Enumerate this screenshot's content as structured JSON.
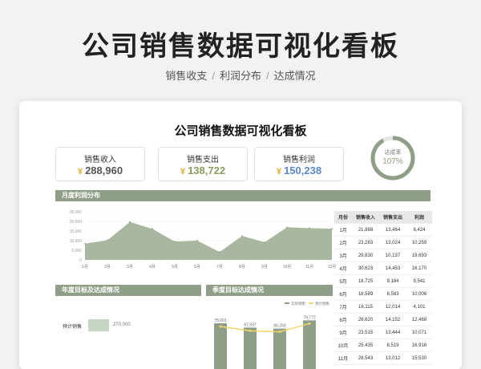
{
  "hero": {
    "title": "公司销售数据可视化看板",
    "subtitle_parts": [
      "销售收支",
      "利润分布",
      "达成情况"
    ],
    "separator": "/"
  },
  "card": {
    "title": "公司销售数据可视化看板",
    "kpis": [
      {
        "label": "销售收入",
        "value": "288,960",
        "icon": "coin-icon"
      },
      {
        "label": "销售支出",
        "value": "138,722",
        "icon": "coin-icon"
      },
      {
        "label": "销售利润",
        "value": "150,238",
        "icon": "coin-icon"
      }
    ],
    "achievement": {
      "label": "达成率",
      "value": "107%",
      "fraction": 1.07
    },
    "sections": {
      "monthly": "月度利润分布",
      "annual": "年度目标及达成情况",
      "quarterly": "季度目标达成情况"
    }
  },
  "chart_data": [
    {
      "type": "area",
      "categories": [
        "1月",
        "2月",
        "3月",
        "4月",
        "5月",
        "6月",
        "7月",
        "8月",
        "9月",
        "10月",
        "11月",
        "12月"
      ],
      "values": [
        8424,
        10259,
        19693,
        16170,
        9541,
        10006,
        4101,
        12468,
        9161,
        16916,
        16500,
        16200
      ],
      "yticks": [
        "25,000",
        "20,000",
        "15,000",
        "10,000",
        "5,000",
        "0"
      ],
      "ylim": [
        0,
        25000
      ],
      "color": "#9aaa8f"
    },
    {
      "type": "bar",
      "legend": [
        "实际销售",
        "预计销售"
      ],
      "values": [
        75001,
        67937,
        66259,
        79772
      ],
      "value_labels": [
        "75,001",
        "67,937",
        "66,259",
        "79,772"
      ],
      "colors": {
        "bar": "#8f9e87",
        "line": "#f3d66e"
      }
    },
    {
      "type": "table",
      "columns": [
        "月份",
        "销售收入",
        "销售支出",
        "利润"
      ],
      "rows": [
        [
          "1月",
          "21,888",
          "13,464",
          "8,424"
        ],
        [
          "2月",
          "23,283",
          "13,024",
          "10,259"
        ],
        [
          "3月",
          "29,830",
          "10,137",
          "19,693"
        ],
        [
          "4月",
          "30,623",
          "14,453",
          "16,170"
        ],
        [
          "5月",
          "18,725",
          "9,184",
          "9,541"
        ],
        [
          "6月",
          "18,589",
          "8,583",
          "10,006"
        ],
        [
          "7月",
          "16,115",
          "12,014",
          "4,101"
        ],
        [
          "8月",
          "26,620",
          "14,152",
          "12,468"
        ],
        [
          "9月",
          "23,515",
          "13,444",
          "10,071"
        ],
        [
          "10月",
          "25,435",
          "8,519",
          "16,916"
        ],
        [
          "11月",
          "28,543",
          "13,012",
          "15,530"
        ]
      ]
    },
    {
      "type": "bar",
      "label": "预计销售",
      "value_label": "270,000"
    }
  ]
}
